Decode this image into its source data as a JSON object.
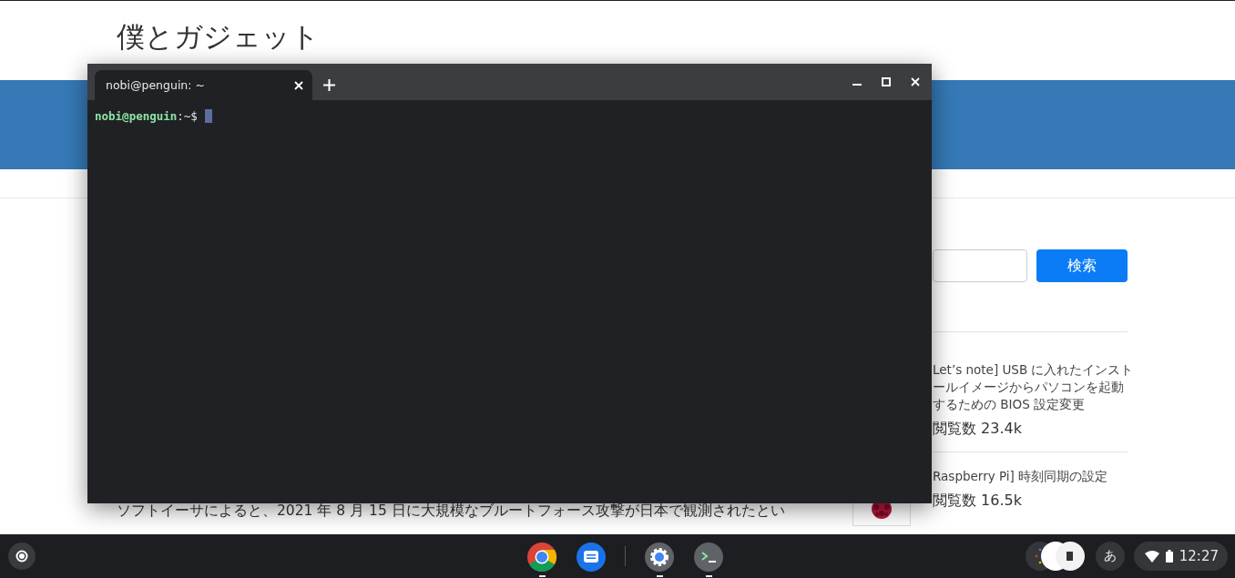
{
  "webpage": {
    "site_title": "僕とガジェット",
    "search_button": "検索",
    "popular_posts": [
      {
        "title_lines": [
          "Let’s note] USB に入れたインスト",
          "ールイメージからパソコンを起動",
          "するための BIOS 設定変更"
        ],
        "views": "閲覧数 23.4k"
      },
      {
        "title_lines": [
          "Raspberry Pi] 時刻同期の設定"
        ],
        "views": "閲覧数 16.5k",
        "thumbnail": {
          "kind": "picture"
        }
      }
    ],
    "article_text": "ソフトイーサによると、2021 年 8 月 15 日に大規模なブルートフォース攻撃が日本で観測されたとい"
  },
  "terminal": {
    "tabs": [
      {
        "title": "nobi@penguin: ~",
        "selected": true
      }
    ],
    "prompt": {
      "user_host": "nobi@penguin",
      "path": ":~$"
    }
  },
  "taskbar": {
    "apps": [
      {
        "kind": "chrome",
        "running": true
      },
      {
        "kind": "messages",
        "running": false
      },
      {
        "kind": "settings",
        "running": true
      },
      {
        "kind": "terminal",
        "running": true
      }
    ],
    "ime": "あ",
    "time": "12:27"
  }
}
